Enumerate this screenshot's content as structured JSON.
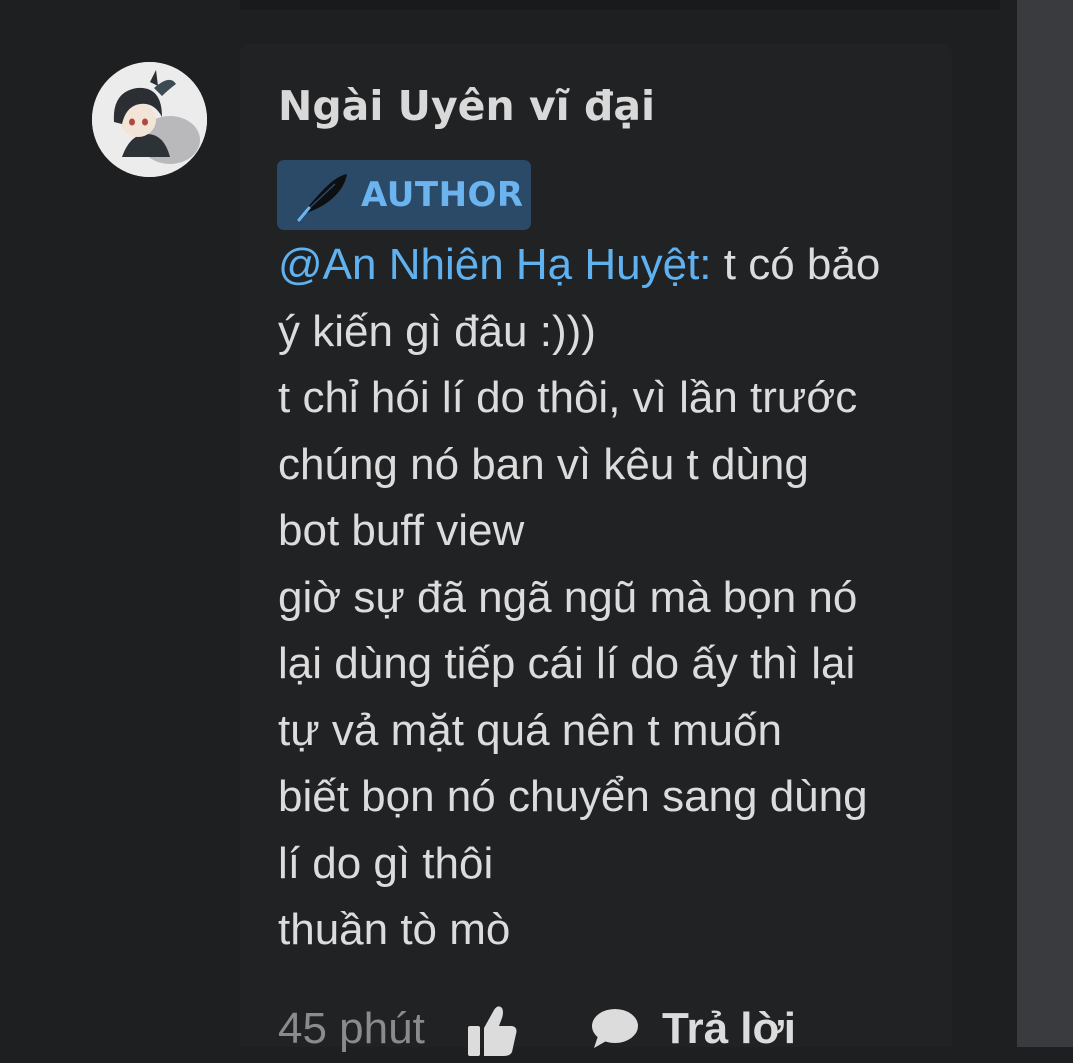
{
  "comment": {
    "username": "Ngài Uyên vĩ đại",
    "badge": {
      "label": "AUTHOR",
      "icon": "feather-icon",
      "background_color": "#2a4a68",
      "text_color": "#6cb4ef"
    },
    "mention": "@An Nhiên Hạ Huyệt:",
    "lines": [
      " t có bảo",
      "ý kiến gì đâu :)))",
      "t chỉ hói lí do thôi, vì lần trước",
      "chúng nó ban vì kêu t dùng",
      "bot buff view",
      "giờ sự đã ngã ngũ mà bọn nó",
      "lại dùng tiếp cái lí do ấy thì lại",
      "tự vả mặt quá nên t muốn",
      "biết bọn nó chuyển sang dùng",
      "lí do gì thôi",
      "thuần tò mò"
    ],
    "footer": {
      "timestamp": "45 phút",
      "like_icon": "thumbs-up-icon",
      "reply_icon": "speech-bubble-icon",
      "reply_label": "Trả lời"
    }
  },
  "colors": {
    "background": "#1e1f21",
    "card": "#212224",
    "text": "#dcdcdc",
    "mention": "#5fb1f0",
    "muted": "#8a8b8d"
  }
}
